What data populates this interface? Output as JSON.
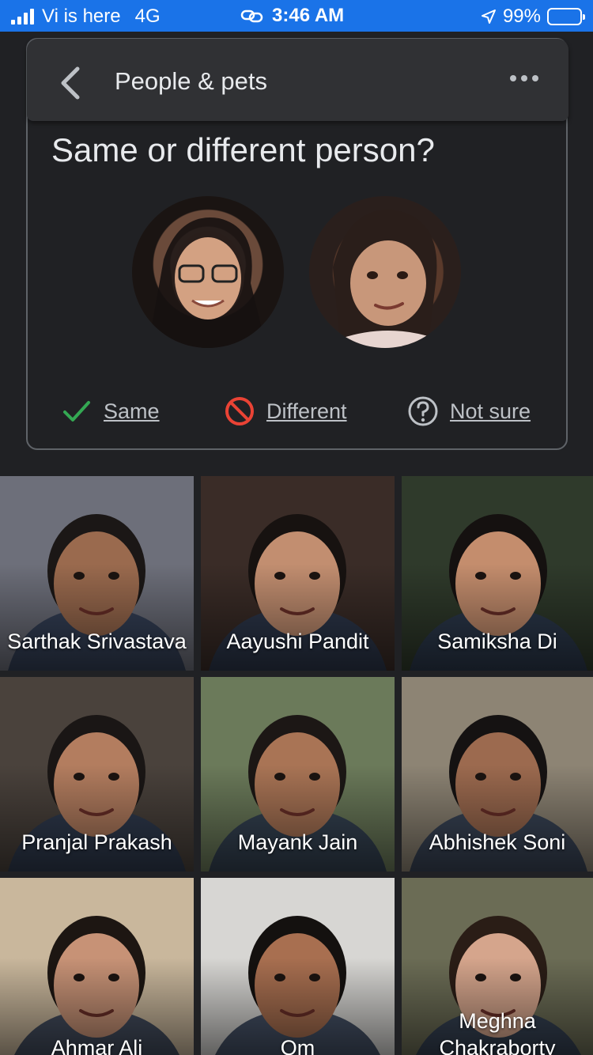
{
  "status_bar": {
    "carrier": "Vi is here",
    "network": "4G",
    "time": "3:46 AM",
    "battery": "99%",
    "battery_level": 0.99
  },
  "header": {
    "title": "People & pets"
  },
  "prompt": {
    "question": "Same or different person?"
  },
  "actions": {
    "same": "Same",
    "different": "Different",
    "not_sure": "Not sure"
  },
  "colors": {
    "status_bar": "#1a73e8",
    "background": "#202124",
    "header": "#303134",
    "same_icon": "#34a853",
    "different_icon": "#ea4335"
  },
  "people": [
    {
      "name": "Sarthak Srivastava",
      "bg": "#6d6f7a",
      "skin": "#9a6a4e",
      "hair": "#1b1716"
    },
    {
      "name": "Aayushi Pandit",
      "bg": "#3a2c27",
      "skin": "#c28e70",
      "hair": "#171210"
    },
    {
      "name": "Samiksha Di",
      "bg": "#2f3a2b",
      "skin": "#c48d6d",
      "hair": "#151110"
    },
    {
      "name": "Pranjal Prakash",
      "bg": "#4a423c",
      "skin": "#b37d5f",
      "hair": "#1a1615"
    },
    {
      "name": "Mayank Jain",
      "bg": "#6b7a5a",
      "skin": "#a97455",
      "hair": "#1c1715"
    },
    {
      "name": "Abhishek Soni",
      "bg": "#8d8474",
      "skin": "#9c6a4f",
      "hair": "#151212"
    },
    {
      "name": "Ahmar Ali",
      "bg": "#c9b79c",
      "skin": "#c79276",
      "hair": "#1d1612"
    },
    {
      "name": "Om",
      "bg": "#d7d6d3",
      "skin": "#a86f50",
      "hair": "#14110f"
    },
    {
      "name": "Meghna Chakraborty",
      "bg": "#6b6c55",
      "skin": "#d5a58c",
      "hair": "#2a1d16"
    }
  ]
}
